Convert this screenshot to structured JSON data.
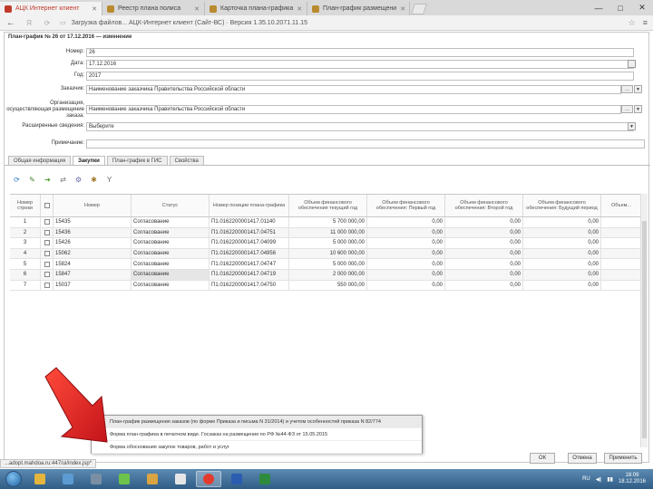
{
  "browser": {
    "tabs": [
      {
        "label": "АЦК Интернет клиент",
        "active": true
      },
      {
        "label": "Реестр плана полиса",
        "active": false
      },
      {
        "label": "Карточка плана-графика",
        "active": false
      },
      {
        "label": "План-график размещени",
        "active": false
      }
    ],
    "address": "Загрузка файлов... АЦК-Интернет клиент (Сайт-ВС) · Версия 1.35.10.2071.11.15",
    "window_controls": {
      "minimize": "—",
      "maximize": "□",
      "close": "✕"
    }
  },
  "app": {
    "title": "План-график № 26 от 17.12.2016 — изменение",
    "fields": [
      {
        "label": "Номер:",
        "value": "26"
      },
      {
        "label": "Дата:",
        "value": "17.12.2016"
      },
      {
        "label": "Год:",
        "value": "2017"
      },
      {
        "label": "Заказчик:",
        "value": "Наименование заказчика Правительства Российской области"
      },
      {
        "label": "Организация, осуществляющая размещение заказа:",
        "value": "Наименование заказчика Правительства Российской области"
      },
      {
        "label": "Расширенные сведения:",
        "value": "Выберите"
      },
      {
        "label": "Примечание:",
        "value": ""
      }
    ],
    "inner_tabs": [
      {
        "label": "Общая информация",
        "active": false
      },
      {
        "label": "Закупки",
        "active": true
      },
      {
        "label": "План-график в ГИС",
        "active": false
      },
      {
        "label": "Свойства",
        "active": false
      }
    ],
    "toolbar": [
      {
        "name": "refresh-icon",
        "glyph": "⟳",
        "color": "#2b7bc9"
      },
      {
        "name": "edit-icon",
        "glyph": "✎",
        "color": "#3f7f2f"
      },
      {
        "name": "add-icon",
        "glyph": "➔",
        "color": "#4a9a2a"
      },
      {
        "name": "move-icon",
        "glyph": "⇄",
        "color": "#7a7a7a"
      },
      {
        "name": "settings-icon",
        "glyph": "⚙",
        "color": "#6b6bb0"
      },
      {
        "name": "filter-icon",
        "glyph": "✱",
        "color": "#a07a2a"
      },
      {
        "name": "funnel-icon",
        "glyph": "Y",
        "color": "#666666"
      }
    ],
    "grid": {
      "columns": [
        "Номер строки",
        "",
        "Номер",
        "Статус",
        "Номер позиции плана-графика",
        "Объем финансового обеспечения текущий год",
        "Объем финансового обеспечения: Первый год",
        "Объем финансового обеспечения: Второй год",
        "Объем финансового обеспечения: Будущий период",
        "Объем..."
      ],
      "rows": [
        {
          "n": "1",
          "num": "15435",
          "status": "Согласование",
          "pos": "П1.0162200001417.01140",
          "v1": "5 700 000,00",
          "v2": "0,00",
          "v3": "0,00",
          "v4": "0,00",
          "hl": false
        },
        {
          "n": "2",
          "num": "15436",
          "status": "Согласование",
          "pos": "П1.0162200001417.04751",
          "v1": "11 000 000,00",
          "v2": "0,00",
          "v3": "0,00",
          "v4": "0,00",
          "hl": false
        },
        {
          "n": "3",
          "num": "15426",
          "status": "Согласование",
          "pos": "П1.0162200001417.04099",
          "v1": "5 000 000,00",
          "v2": "0,00",
          "v3": "0,00",
          "v4": "0,00",
          "hl": false
        },
        {
          "n": "4",
          "num": "15062",
          "status": "Согласование",
          "pos": "П1.0162200001417.04956",
          "v1": "10 600 000,00",
          "v2": "0,00",
          "v3": "0,00",
          "v4": "0,00",
          "hl": false
        },
        {
          "n": "5",
          "num": "15824",
          "status": "Согласование",
          "pos": "П1.0162200001417.04747",
          "v1": "5 000 000,00",
          "v2": "0,00",
          "v3": "0,00",
          "v4": "0,00",
          "hl": false
        },
        {
          "n": "6",
          "num": "15847",
          "status": "Согласование",
          "pos": "П1.0162200001417.04719",
          "v1": "2 000 000,00",
          "v2": "0,00",
          "v3": "0,00",
          "v4": "0,00",
          "hl": true
        },
        {
          "n": "7",
          "num": "15037",
          "status": "Согласование",
          "pos": "П1.0162200001417.04750",
          "v1": "550 000,00",
          "v2": "0,00",
          "v3": "0,00",
          "v4": "0,00",
          "hl": false
        }
      ]
    },
    "popup_items": [
      "План-график размещения заказов (по форме Приказа и письма N 31/2014) и учетом особенностей приказа N 82/774",
      "Форма план-графика в печатном виде. Госзаказ на размещение по РФ №44-ФЗ от 15.05.2015",
      "Форма обоснования закупок товаров, работ и услуг"
    ],
    "buttons": {
      "ok": "ОК",
      "cancel": "Отмена",
      "apply": "Применить"
    }
  },
  "status_url": "...adopt.mahdoa.ru:447/ui/index.jsp*",
  "taskbar": {
    "clock_time": "18:09",
    "clock_date": "18.12.2016",
    "lang": "RU"
  }
}
